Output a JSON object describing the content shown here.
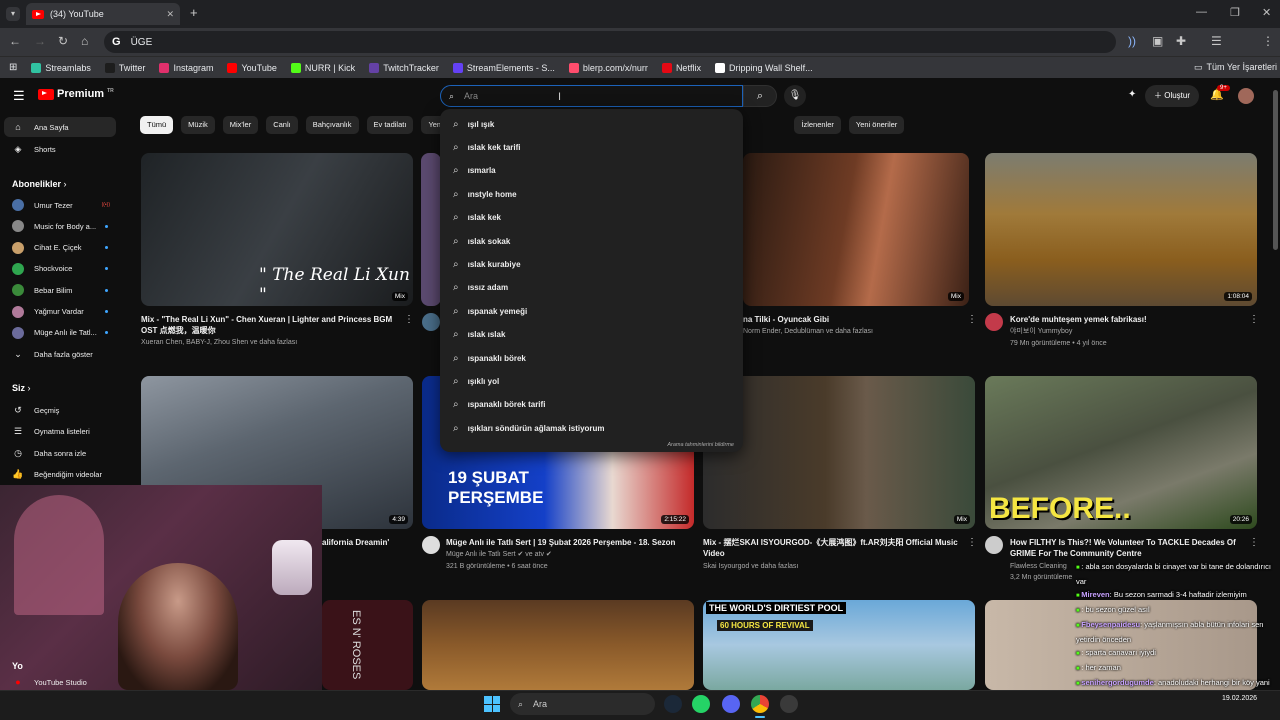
{
  "browser": {
    "tab_title": "(34) YouTube",
    "tab_count": "",
    "address": "ÜGE",
    "new_tab": "+",
    "bookmarks": [
      {
        "label": "Streamlabs",
        "color": "#31c3a2"
      },
      {
        "label": "Twitter",
        "color": "#1d1d1d"
      },
      {
        "label": "Instagram",
        "color": "#e1306c"
      },
      {
        "label": "YouTube",
        "color": "#ff0000"
      },
      {
        "label": "NURR | Kick",
        "color": "#53fc18"
      },
      {
        "label": "TwitchTracker",
        "color": "#6441a5"
      },
      {
        "label": "StreamElements - S...",
        "color": "#6441f5"
      },
      {
        "label": "blerp.com/x/nurr",
        "color": "#ff4d6d"
      },
      {
        "label": "Netflix",
        "color": "#e50914"
      },
      {
        "label": "Dripping Wall Shelf...",
        "color": "#ffffff"
      }
    ],
    "all_bookmarks": "Tüm Yer İşaretleri"
  },
  "youtube": {
    "logo": "Premium",
    "logo_sup": "TR",
    "search_placeholder": "Ara",
    "create_label": "Oluştur",
    "notif_count": "9+",
    "chips": [
      "Tümü",
      "Müzik",
      "Mix'ler",
      "Canlı",
      "Bahçıvanlık",
      "Ev tadilatı",
      "Yemek p",
      "İzlenenler",
      "Yeni öneriler"
    ],
    "sidebar": {
      "main": [
        {
          "label": "Ana Sayfa",
          "icon": "home-icon"
        },
        {
          "label": "Shorts",
          "icon": "shorts-icon"
        }
      ],
      "subs_header": "Abonelikler",
      "subs": [
        {
          "label": "Umur Tezer",
          "color": "#4a6fa5",
          "badge": "live"
        },
        {
          "label": "Music for Body a...",
          "color": "#888",
          "badge": "dot"
        },
        {
          "label": "Cihat E. Çiçek",
          "color": "#c89f6a",
          "badge": "dot"
        },
        {
          "label": "Shockvoice",
          "color": "#2fa64f",
          "badge": "dot"
        },
        {
          "label": "Bebar Bilim",
          "color": "#3a8a3a",
          "badge": "dot"
        },
        {
          "label": "Yağmur Vardar",
          "color": "#b07a9a",
          "badge": "dot"
        },
        {
          "label": "Müge Anlı ile Tatl...",
          "color": "#6b6b9b",
          "badge": "dot"
        }
      ],
      "more": "Daha fazla göster",
      "you_header": "Siz",
      "you": [
        {
          "label": "Geçmiş",
          "icon": "history-icon"
        },
        {
          "label": "Oynatma listeleri",
          "icon": "playlist-icon"
        },
        {
          "label": "Daha sonra izle",
          "icon": "clock-icon"
        },
        {
          "label": "Beğendiğim videolar",
          "icon": "like-icon"
        }
      ],
      "studio_header": "Yo",
      "studio": "YouTube Studio"
    },
    "suggestions": [
      "ışıl ışık",
      "ıslak kek tarifi",
      "ısmarla",
      "ınstyle home",
      "ıslak kek",
      "ıslak sokak",
      "ıslak kurabiye",
      "ıssız adam",
      "ıspanak yemeği",
      "ıslak ıslak",
      "ıspanaklı börek",
      "ışıklı yol",
      "ıspanaklı börek tarifi",
      "ışıkları söndürün ağlamak istiyorum"
    ],
    "suggest_footer": "Arama tahminlerini bildirme",
    "videos": [
      {
        "title1": "Mix - \"The Real Li Xun\" - Chen Xueran | Lighter and Princess BGM",
        "title2": "OST 点燃我，温暖你",
        "meta1": "Xueran Chen, BABY-J, Zhou Shen ve daha fazlası",
        "meta2": "",
        "dur": "Mix",
        "overlay": "\" The Real Li Xun \""
      },
      {
        "title1": "na Tilki - Oyuncak Gibi",
        "title2": "",
        "meta1": "Norm Ender, Dedublüman ve daha fazlası",
        "meta2": "",
        "dur": "Mix",
        "overlay": ""
      },
      {
        "title1": "Kore'de muhteşem yemek fabrikası!",
        "title2": "",
        "meta1": "야미보이 Yummyboy",
        "meta2": "79 Mn görüntüleme • 4 yıl önce",
        "dur": "1:08:04",
        "overlay": ""
      },
      {
        "title1": "alifornia Dreamin'",
        "title2": "",
        "meta1": "",
        "meta2": "",
        "dur": "4:39",
        "overlay": ""
      },
      {
        "title1": "Müge Anlı ile Tatlı Sert | 19 Şubat 2026 Perşembe - 18. Sezon",
        "title2": "",
        "meta1": "Müge Anlı ile Tatlı Sert ✔ ve atv ✔",
        "meta2": "321 B görüntüleme • 6 saat önce",
        "dur": "2:15:22",
        "overlay": "19 ŞUBAT PERŞEMBE"
      },
      {
        "title1": "Mix - 摆烂SKAI ISYOURGOD-《大展鸿图》ft.AR刘夫阳 Official Music",
        "title2": "Video",
        "meta1": "Skai Isyourgod ve daha fazlası",
        "meta2": "",
        "dur": "Mix",
        "overlay": ""
      },
      {
        "title1": "How FILTHY Is This?! We Volunteer To TACKLE Decades Of",
        "title2": "GRIME For The Community Centre",
        "meta1": "Flawless Cleaning",
        "meta2": "3,2 Mn görüntüleme",
        "dur": "20:26",
        "overlay": "BEFORE.."
      },
      {
        "title1": "",
        "title2": "",
        "meta1": "",
        "meta2": "",
        "dur": "",
        "overlay": "THE WORLD'S DIRTIEST POOL"
      },
      {
        "title1": "",
        "title2": "",
        "meta1": "",
        "meta2": "",
        "dur": "",
        "overlay": "60 HOURS OF REVIVAL"
      }
    ],
    "bottom_overlay": "ES N' ROSES"
  },
  "chat": [
    {
      "name": "",
      "text": ": abla son dosyalarda bi cinayet var bi tane de dolandırıcı var"
    },
    {
      "name": "Mireven",
      "text": ": Bu sezon sarmadi 3-4 haftadir izlemiyim"
    },
    {
      "name": "",
      "text": ": bu sezon güzel asıl"
    },
    {
      "name": "Fbeysenpaidesu",
      "text": ": yaşlanmışsın abla bütün infolari sen yetirdin önceden"
    },
    {
      "name": "",
      "text": ": sparta canavarı iyiydi"
    },
    {
      "name": "",
      "text": ""
    },
    {
      "name": "",
      "text": ": her zaman"
    },
    {
      "name": "senihergordugumde",
      "text": ": anadoludaki herhangi bir köy yani"
    }
  ],
  "taskbar": {
    "search": "Ara",
    "date": "19.02.2026"
  }
}
